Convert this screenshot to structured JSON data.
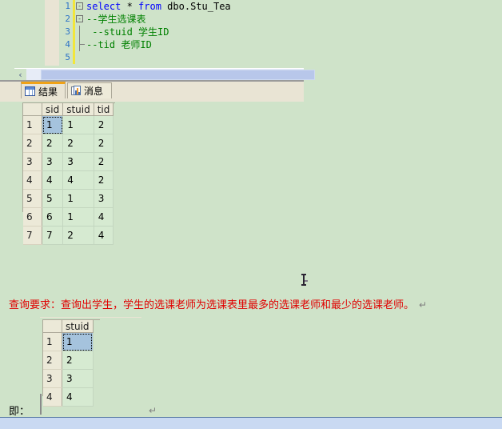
{
  "colors": {
    "page_background": "#cfe3c9",
    "keyword_blue": "#0000ff",
    "comment_green": "#008000",
    "requirement_red": "#e00000",
    "selected_cell_blue": "#a5c3dd",
    "tab_active_accent": "#f0a216",
    "grid_header_beige": "#ece9d8",
    "change_bar_yellow": "#f2e63c",
    "scrollbar_thumb": "#b8c7ea",
    "bottom_bar_blue": "#c9d9f2"
  },
  "editor": {
    "lines": [
      {
        "number": "1",
        "outline": "collapse-box",
        "outline_glyph": "-",
        "segments": [
          {
            "text": "select",
            "style": "kw"
          },
          {
            "text": " * ",
            "style": "pl"
          },
          {
            "text": "from",
            "style": "kw"
          },
          {
            "text": " dbo.Stu_Tea",
            "style": "pl"
          }
        ]
      },
      {
        "number": "2",
        "outline": "collapse-box",
        "outline_glyph": "-",
        "segments": [
          {
            "text": "--学生选课表",
            "style": "cm"
          }
        ]
      },
      {
        "number": "3",
        "outline": "line",
        "outline_glyph": "",
        "segments": [
          {
            "text": " --stuid 学生ID",
            "style": "cm"
          }
        ]
      },
      {
        "number": "4",
        "outline": "tick",
        "outline_glyph": "",
        "segments": [
          {
            "text": "--tid 老师ID",
            "style": "cm"
          }
        ]
      },
      {
        "number": "5",
        "outline": "none",
        "outline_glyph": "",
        "segments": []
      }
    ],
    "hscrollbar": {
      "left_arrow_glyph": "‹"
    }
  },
  "tabs": [
    {
      "label": "结果",
      "icon": "grid-icon",
      "active": true
    },
    {
      "label": "消息",
      "icon": "report-icon",
      "active": false
    }
  ],
  "results_grid": {
    "columns": [
      "sid",
      "stuid",
      "tid"
    ],
    "row_numbers": [
      "1",
      "2",
      "3",
      "4",
      "5",
      "6",
      "7"
    ],
    "rows": [
      [
        "1",
        "1",
        "2"
      ],
      [
        "2",
        "2",
        "2"
      ],
      [
        "3",
        "3",
        "2"
      ],
      [
        "4",
        "4",
        "2"
      ],
      [
        "5",
        "1",
        "3"
      ],
      [
        "6",
        "1",
        "4"
      ],
      [
        "7",
        "2",
        "4"
      ]
    ],
    "selected_cell": {
      "row": 0,
      "col": 0
    }
  },
  "second_grid": {
    "columns": [
      "stuid"
    ],
    "row_numbers": [
      "1",
      "2",
      "3",
      "4"
    ],
    "rows": [
      [
        "1"
      ],
      [
        "2"
      ],
      [
        "3"
      ],
      [
        "4"
      ]
    ],
    "selected_cell": {
      "row": 0,
      "col": 0
    }
  },
  "document": {
    "requirement": "查询要求：查询出学生，学生的选课老师为选课表里最多的选课老师和最少的选课老师。",
    "requirement_pilcrow": "↵",
    "conclusion": "即：",
    "conclusion_pilcrow": "↵"
  }
}
